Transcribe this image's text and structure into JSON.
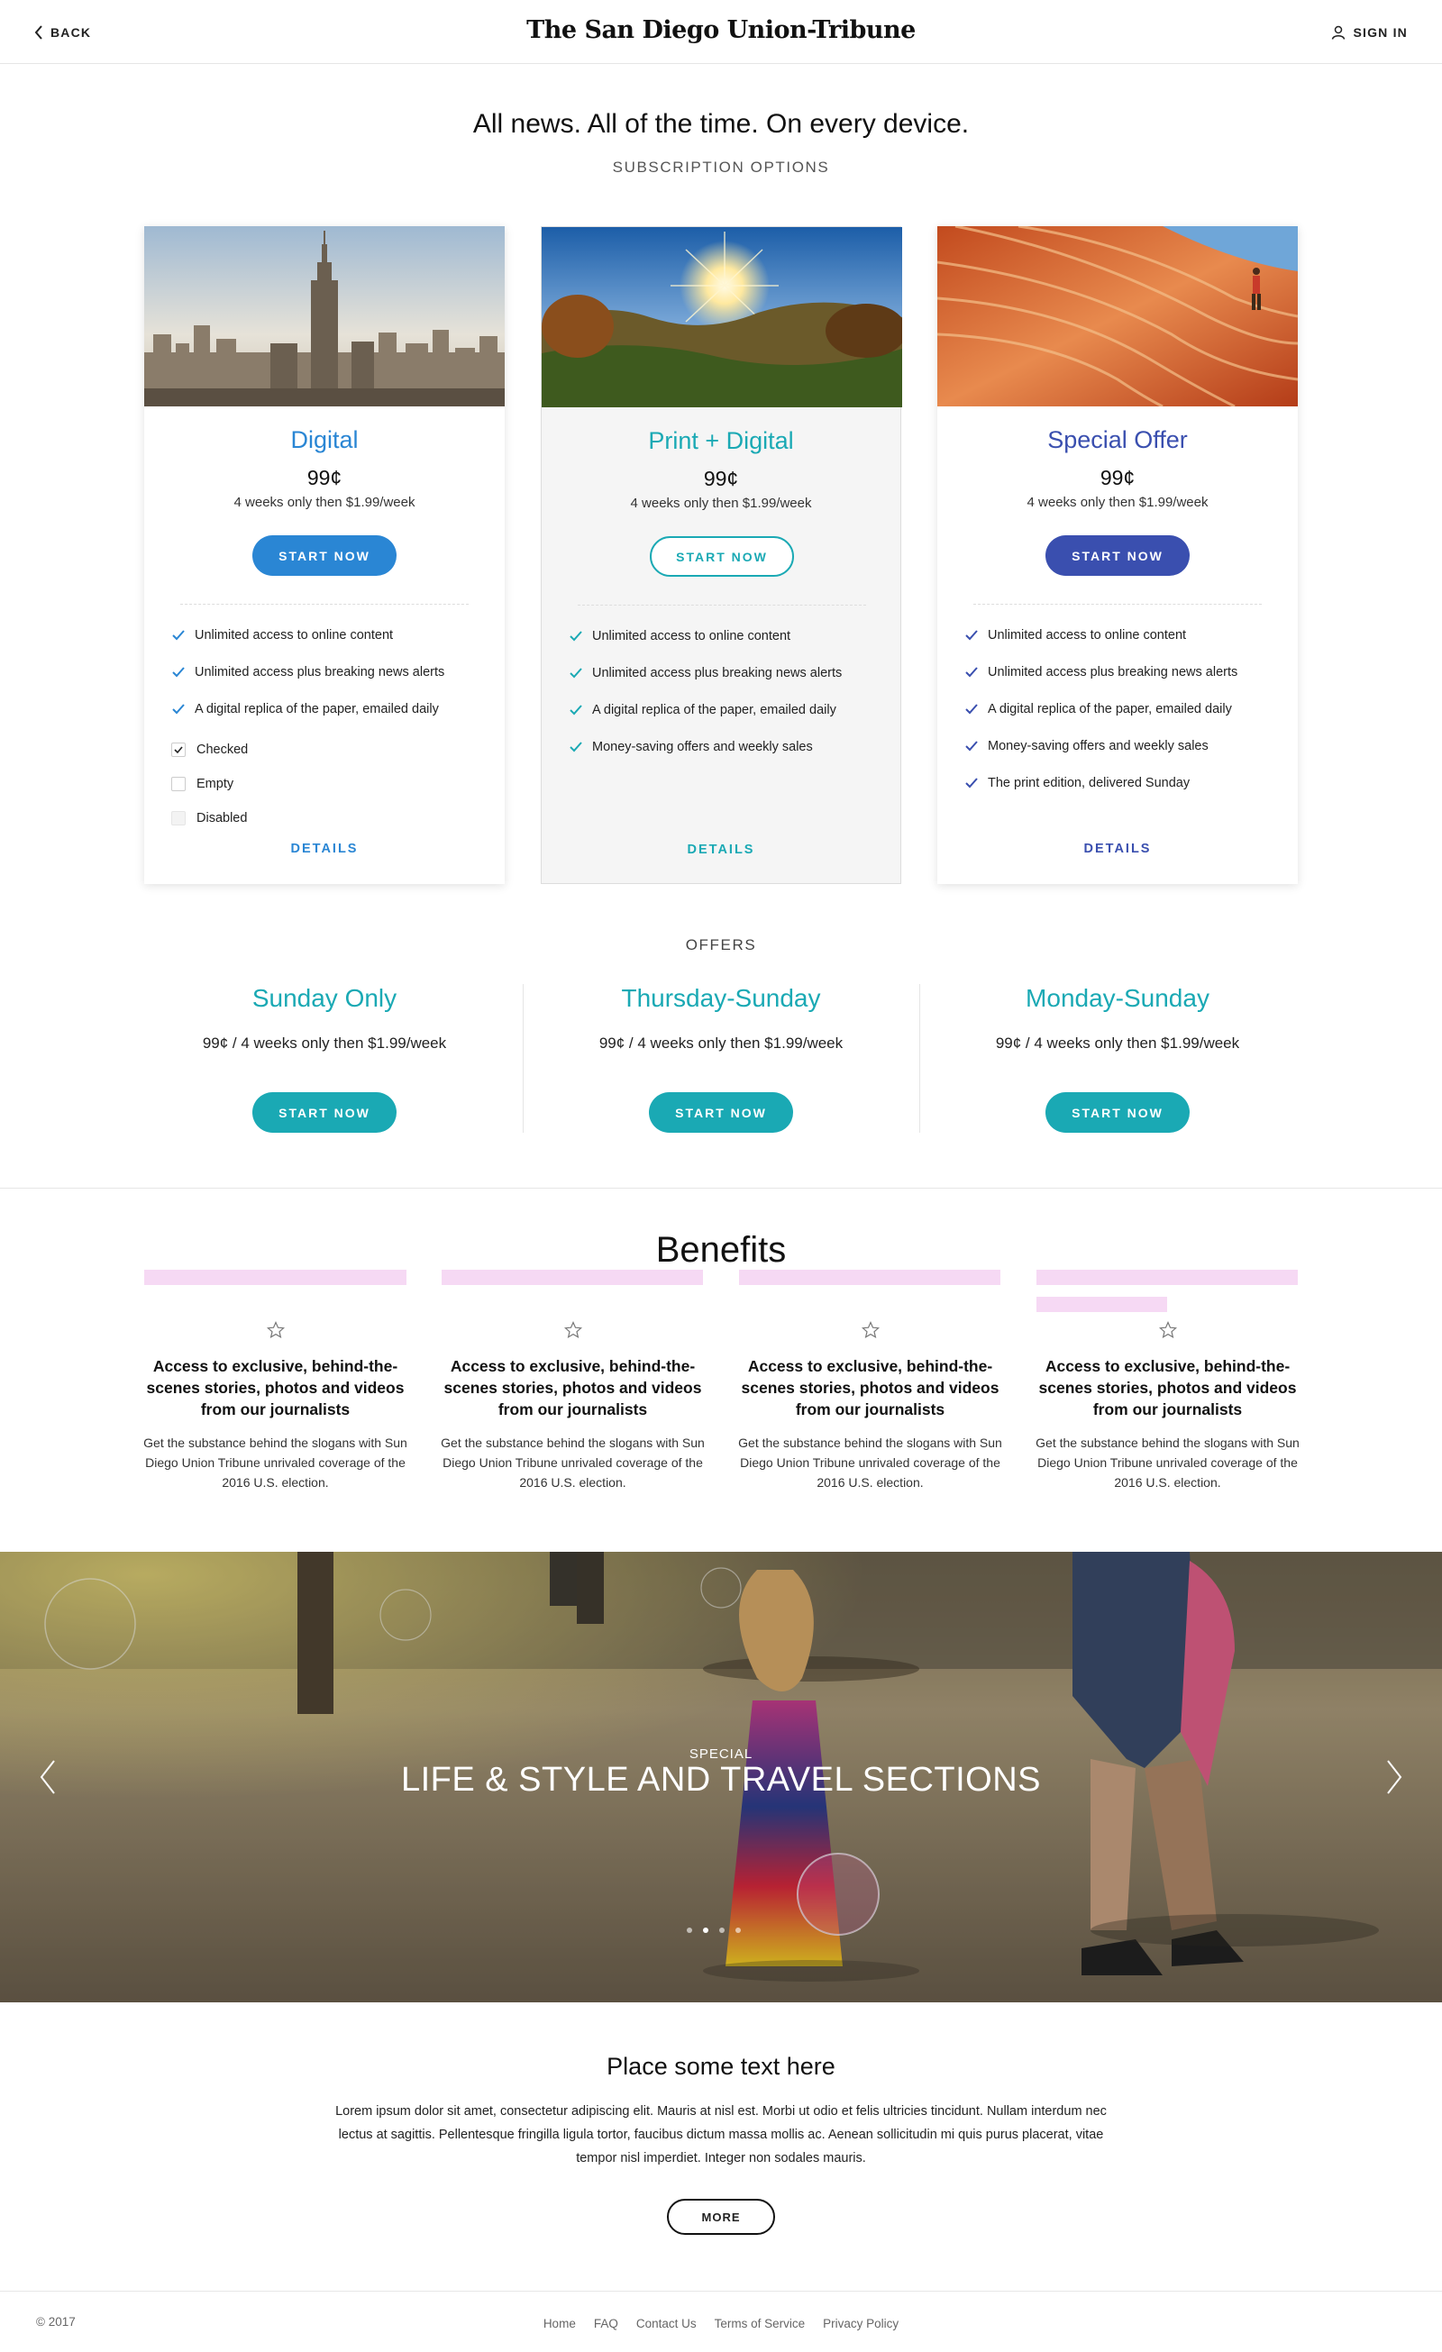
{
  "header": {
    "back_label": "BACK",
    "logo": "The San Diego Union-Tribune",
    "signin_label": "SIGN IN"
  },
  "hero": {
    "title": "All news. All of the time. On every device.",
    "subtitle": "SUBSCRIPTION OPTIONS"
  },
  "plans": [
    {
      "title": "Digital",
      "price": "99¢",
      "terms": "4 weeks only then $1.99/week",
      "button": "START NOW",
      "features": [
        "Unlimited access to online content",
        "Unlimited access plus breaking news alerts",
        "A digital replica of the paper, emailed daily"
      ],
      "checkboxes": [
        {
          "label": "Checked",
          "state": "checked"
        },
        {
          "label": "Empty",
          "state": "empty"
        },
        {
          "label": "Disabled",
          "state": "disabled"
        }
      ],
      "details": "DETAILS",
      "accent": "#2a86d4"
    },
    {
      "title": "Print + Digital",
      "price": "99¢",
      "terms": "4 weeks only then $1.99/week",
      "button": "START NOW",
      "features": [
        "Unlimited access to online content",
        "Unlimited access plus breaking news alerts",
        "A digital replica of the paper, emailed daily",
        "Money-saving offers and weekly sales"
      ],
      "details": "DETAILS",
      "accent": "#1aa9b4"
    },
    {
      "title": "Special Offer",
      "price": "99¢",
      "terms": "4 weeks only then $1.99/week",
      "button": "START NOW",
      "features": [
        "Unlimited access to online content",
        "Unlimited access plus breaking news alerts",
        "A digital replica of the paper, emailed daily",
        "Money-saving offers and weekly sales",
        "The print edition, delivered Sunday"
      ],
      "details": "DETAILS",
      "accent": "#3a4faf"
    }
  ],
  "offers": {
    "title": "OFFERS",
    "items": [
      {
        "title": "Sunday Only",
        "terms": "99¢ / 4 weeks only then $1.99/week",
        "button": "START NOW"
      },
      {
        "title": "Thursday-Sunday",
        "terms": "99¢ / 4 weeks only then $1.99/week",
        "button": "START NOW"
      },
      {
        "title": "Monday-Sunday",
        "terms": "99¢ / 4 weeks only then $1.99/week",
        "button": "START NOW"
      }
    ]
  },
  "benefits": {
    "title": "Benefits",
    "items": [
      {
        "icon": "star-icon",
        "heading": "Access to exclusive, behind-the-scenes stories, photos and videos from our journalists",
        "body": "Get the substance behind the slogans with Sun Diego Union Tribune unrivaled coverage of the 2016 U.S. election."
      },
      {
        "icon": "star-icon",
        "heading": "Access to exclusive, behind-the-scenes stories, photos and videos from our journalists",
        "body": "Get the substance behind the slogans with Sun Diego Union Tribune unrivaled coverage of the 2016 U.S. election."
      },
      {
        "icon": "star-icon",
        "heading": "Access to exclusive, behind-the-scenes stories, photos and videos from our journalists",
        "body": "Get the substance behind the slogans with Sun Diego Union Tribune unrivaled coverage of the 2016 U.S. election."
      },
      {
        "icon": "star-icon",
        "heading": "Access to exclusive, behind-the-scenes stories, photos and videos from our journalists",
        "body": "Get the substance behind the slogans with Sun Diego Union Tribune unrivaled coverage of the 2016 U.S. election."
      }
    ]
  },
  "carousel": {
    "tag": "SPECIAL",
    "title": "LIFE & STYLE AND TRAVEL SECTIONS",
    "dot_count": 4,
    "active_dot": 1
  },
  "text_section": {
    "title": "Place some text here",
    "body": "Lorem ipsum dolor sit amet, consectetur adipiscing elit. Mauris at nisl est. Morbi ut odio et felis ultricies tincidunt. Nullam interdum nec lectus at sagittis. Pellentesque fringilla ligula tortor, faucibus dictum massa mollis ac. Aenean sollicitudin mi quis purus placerat, vitae tempor nisl imperdiet. Integer non sodales mauris.",
    "button": "MORE"
  },
  "footer": {
    "copyright": "© 2017",
    "links": [
      "Home",
      "FAQ",
      "Contact Us",
      "Terms of Service",
      "Privacy Policy"
    ]
  }
}
